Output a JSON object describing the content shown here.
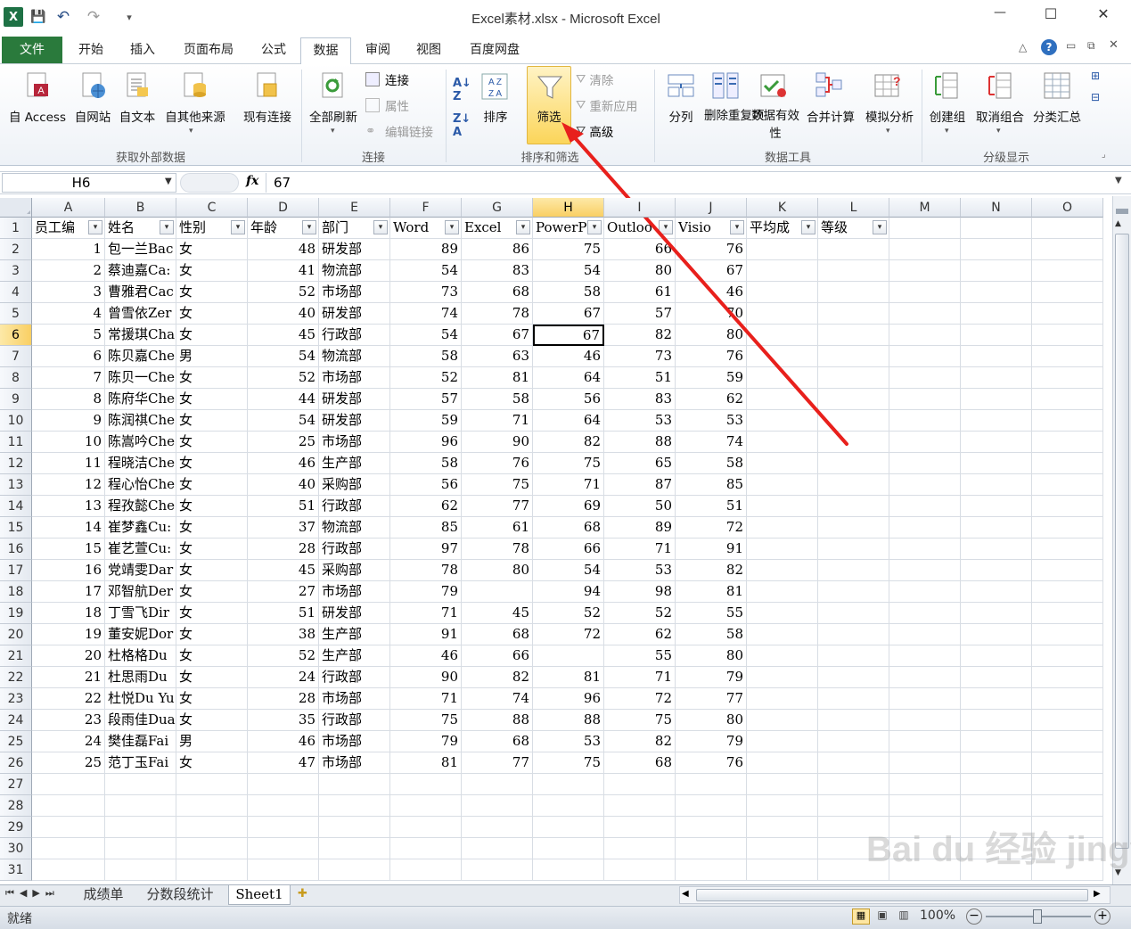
{
  "window": {
    "title": "Excel素材.xlsx - Microsoft Excel",
    "controls": {
      "minimize": "—",
      "maximize": "☐",
      "close": "✕"
    }
  },
  "qat": {
    "app_icon": "X",
    "save": "💾",
    "undo": "↶",
    "redo": "↷",
    "customize": "▾"
  },
  "tabs": [
    "文件",
    "开始",
    "插入",
    "页面布局",
    "公式",
    "数据",
    "审阅",
    "视图",
    "百度网盘"
  ],
  "active_tab": "数据",
  "ribbon": {
    "groups": {
      "external": {
        "label": "获取外部数据",
        "buttons": [
          "自 Access",
          "自网站",
          "自文本",
          "自其他来源",
          "现有连接"
        ]
      },
      "connections": {
        "label": "连接",
        "refresh_all": "全部刷新",
        "small": [
          "连接",
          "属性",
          "编辑链接"
        ]
      },
      "sort_filter": {
        "label": "排序和筛选",
        "sort": "排序",
        "filter": "筛选",
        "small": [
          "清除",
          "重新应用",
          "高级"
        ]
      },
      "data_tools": {
        "label": "数据工具",
        "buttons": [
          "分列",
          "删除重复项",
          "数据有效性",
          "合并计算",
          "模拟分析"
        ]
      },
      "outline": {
        "label": "分级显示",
        "buttons": [
          "创建组",
          "取消组合",
          "分类汇总"
        ]
      }
    }
  },
  "formula_bar": {
    "name_box": "H6",
    "fx": "fx",
    "value": "67"
  },
  "columns": [
    "A",
    "B",
    "C",
    "D",
    "E",
    "F",
    "G",
    "H",
    "I",
    "J",
    "K",
    "L",
    "M",
    "N",
    "O"
  ],
  "selected_cell": {
    "column": "H",
    "row": 6
  },
  "headers": [
    "员工编",
    "姓名",
    "性别",
    "年龄",
    "部门",
    "Word",
    "Excel",
    "PowerP",
    "Outloo",
    "Visio",
    "平均成",
    "等级"
  ],
  "rows": [
    [
      "1",
      "包一兰Bac",
      "女",
      "48",
      "研发部",
      "89",
      "86",
      "75",
      "66",
      "76"
    ],
    [
      "2",
      "蔡迪嘉Ca:",
      "女",
      "41",
      "物流部",
      "54",
      "83",
      "54",
      "80",
      "67"
    ],
    [
      "3",
      "曹雅君Cac",
      "女",
      "52",
      "市场部",
      "73",
      "68",
      "58",
      "61",
      "46"
    ],
    [
      "4",
      "曾雪依Zer",
      "女",
      "40",
      "研发部",
      "74",
      "78",
      "67",
      "57",
      "70"
    ],
    [
      "5",
      "常援琪Cha",
      "女",
      "45",
      "行政部",
      "54",
      "67",
      "67",
      "82",
      "80"
    ],
    [
      "6",
      "陈贝嘉Che",
      "男",
      "54",
      "物流部",
      "58",
      "63",
      "46",
      "73",
      "76"
    ],
    [
      "7",
      "陈贝一Che",
      "女",
      "52",
      "市场部",
      "52",
      "81",
      "64",
      "51",
      "59"
    ],
    [
      "8",
      "陈府华Che",
      "女",
      "44",
      "研发部",
      "57",
      "58",
      "56",
      "83",
      "62"
    ],
    [
      "9",
      "陈润祺Che",
      "女",
      "54",
      "研发部",
      "59",
      "71",
      "64",
      "53",
      "53"
    ],
    [
      "10",
      "陈嵩吟Che",
      "女",
      "25",
      "市场部",
      "96",
      "90",
      "82",
      "88",
      "74"
    ],
    [
      "11",
      "程晓洁Che",
      "女",
      "46",
      "生产部",
      "58",
      "76",
      "75",
      "65",
      "58"
    ],
    [
      "12",
      "程心怡Che",
      "女",
      "40",
      "采购部",
      "56",
      "75",
      "71",
      "87",
      "85"
    ],
    [
      "13",
      "程孜懿Che",
      "女",
      "51",
      "行政部",
      "62",
      "77",
      "69",
      "50",
      "51"
    ],
    [
      "14",
      "崔梦鑫Cu:",
      "女",
      "37",
      "物流部",
      "85",
      "61",
      "68",
      "89",
      "72"
    ],
    [
      "15",
      "崔艺萱Cu:",
      "女",
      "28",
      "行政部",
      "97",
      "78",
      "66",
      "71",
      "91"
    ],
    [
      "16",
      "党靖雯Dar",
      "女",
      "45",
      "采购部",
      "78",
      "80",
      "54",
      "53",
      "82"
    ],
    [
      "17",
      "邓智航Der",
      "女",
      "27",
      "市场部",
      "79",
      "",
      "94",
      "98",
      "81"
    ],
    [
      "18",
      "丁雪飞Dir",
      "女",
      "51",
      "研发部",
      "71",
      "45",
      "52",
      "52",
      "55"
    ],
    [
      "19",
      "董安妮Dor",
      "女",
      "38",
      "生产部",
      "91",
      "68",
      "72",
      "62",
      "58"
    ],
    [
      "20",
      "杜格格Du",
      "女",
      "52",
      "生产部",
      "46",
      "66",
      "",
      "55",
      "80"
    ],
    [
      "21",
      "杜思雨Du",
      "女",
      "24",
      "行政部",
      "90",
      "82",
      "81",
      "71",
      "79"
    ],
    [
      "22",
      "杜悦Du Yu",
      "女",
      "28",
      "市场部",
      "71",
      "74",
      "96",
      "72",
      "77"
    ],
    [
      "23",
      "段雨佳Dua",
      "女",
      "35",
      "行政部",
      "75",
      "88",
      "88",
      "75",
      "80"
    ],
    [
      "24",
      "樊佳磊Fai",
      "男",
      "46",
      "市场部",
      "79",
      "68",
      "53",
      "82",
      "79"
    ],
    [
      "25",
      "范丁玉Fai",
      "女",
      "47",
      "市场部",
      "81",
      "77",
      "75",
      "68",
      "76"
    ]
  ],
  "row_numbers": [
    "1",
    "2",
    "3",
    "4",
    "5",
    "6",
    "7",
    "8",
    "9",
    "10",
    "11",
    "12",
    "13",
    "14",
    "15",
    "16",
    "17",
    "18",
    "19",
    "20",
    "21",
    "22",
    "23",
    "24",
    "25",
    "26",
    "27",
    "28",
    "29",
    "30",
    "31"
  ],
  "sheets": [
    "成绩单",
    "分数段统计",
    "Sheet1"
  ],
  "active_sheet": "Sheet1",
  "status": {
    "ready": "就绪",
    "zoom": "100%"
  },
  "watermark": "Bai du 经验 jingyan.baidu.com",
  "colors": {
    "accent_green": "#217346",
    "file_tab": "#2a7a3c",
    "highlight": "#fbe28a",
    "arrow": "#e8201c",
    "selection": "#000000"
  }
}
